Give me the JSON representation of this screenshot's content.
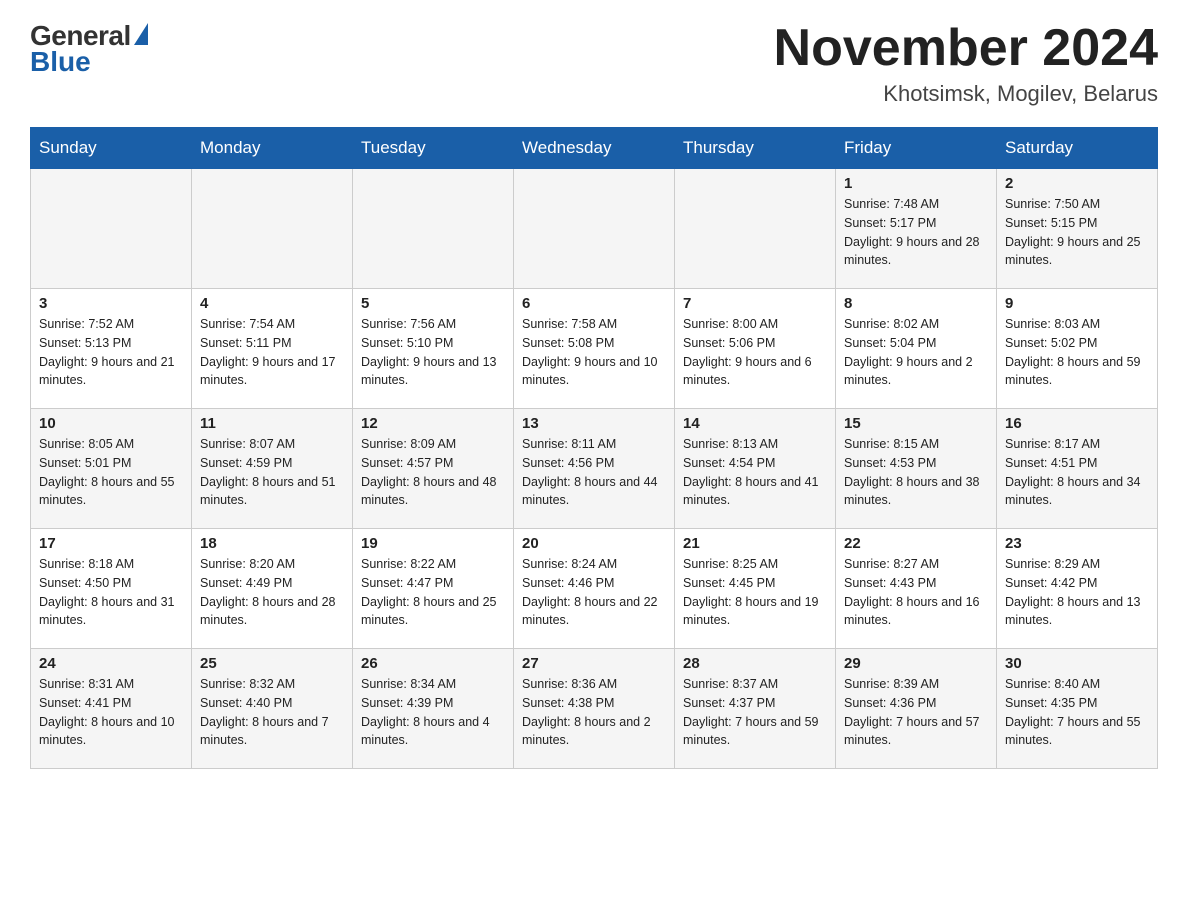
{
  "header": {
    "logo_general": "General",
    "logo_blue": "Blue",
    "month_title": "November 2024",
    "location": "Khotsimsk, Mogilev, Belarus"
  },
  "days_of_week": [
    "Sunday",
    "Monday",
    "Tuesday",
    "Wednesday",
    "Thursday",
    "Friday",
    "Saturday"
  ],
  "weeks": [
    [
      {
        "day": "",
        "info": ""
      },
      {
        "day": "",
        "info": ""
      },
      {
        "day": "",
        "info": ""
      },
      {
        "day": "",
        "info": ""
      },
      {
        "day": "",
        "info": ""
      },
      {
        "day": "1",
        "info": "Sunrise: 7:48 AM\nSunset: 5:17 PM\nDaylight: 9 hours and 28 minutes."
      },
      {
        "day": "2",
        "info": "Sunrise: 7:50 AM\nSunset: 5:15 PM\nDaylight: 9 hours and 25 minutes."
      }
    ],
    [
      {
        "day": "3",
        "info": "Sunrise: 7:52 AM\nSunset: 5:13 PM\nDaylight: 9 hours and 21 minutes."
      },
      {
        "day": "4",
        "info": "Sunrise: 7:54 AM\nSunset: 5:11 PM\nDaylight: 9 hours and 17 minutes."
      },
      {
        "day": "5",
        "info": "Sunrise: 7:56 AM\nSunset: 5:10 PM\nDaylight: 9 hours and 13 minutes."
      },
      {
        "day": "6",
        "info": "Sunrise: 7:58 AM\nSunset: 5:08 PM\nDaylight: 9 hours and 10 minutes."
      },
      {
        "day": "7",
        "info": "Sunrise: 8:00 AM\nSunset: 5:06 PM\nDaylight: 9 hours and 6 minutes."
      },
      {
        "day": "8",
        "info": "Sunrise: 8:02 AM\nSunset: 5:04 PM\nDaylight: 9 hours and 2 minutes."
      },
      {
        "day": "9",
        "info": "Sunrise: 8:03 AM\nSunset: 5:02 PM\nDaylight: 8 hours and 59 minutes."
      }
    ],
    [
      {
        "day": "10",
        "info": "Sunrise: 8:05 AM\nSunset: 5:01 PM\nDaylight: 8 hours and 55 minutes."
      },
      {
        "day": "11",
        "info": "Sunrise: 8:07 AM\nSunset: 4:59 PM\nDaylight: 8 hours and 51 minutes."
      },
      {
        "day": "12",
        "info": "Sunrise: 8:09 AM\nSunset: 4:57 PM\nDaylight: 8 hours and 48 minutes."
      },
      {
        "day": "13",
        "info": "Sunrise: 8:11 AM\nSunset: 4:56 PM\nDaylight: 8 hours and 44 minutes."
      },
      {
        "day": "14",
        "info": "Sunrise: 8:13 AM\nSunset: 4:54 PM\nDaylight: 8 hours and 41 minutes."
      },
      {
        "day": "15",
        "info": "Sunrise: 8:15 AM\nSunset: 4:53 PM\nDaylight: 8 hours and 38 minutes."
      },
      {
        "day": "16",
        "info": "Sunrise: 8:17 AM\nSunset: 4:51 PM\nDaylight: 8 hours and 34 minutes."
      }
    ],
    [
      {
        "day": "17",
        "info": "Sunrise: 8:18 AM\nSunset: 4:50 PM\nDaylight: 8 hours and 31 minutes."
      },
      {
        "day": "18",
        "info": "Sunrise: 8:20 AM\nSunset: 4:49 PM\nDaylight: 8 hours and 28 minutes."
      },
      {
        "day": "19",
        "info": "Sunrise: 8:22 AM\nSunset: 4:47 PM\nDaylight: 8 hours and 25 minutes."
      },
      {
        "day": "20",
        "info": "Sunrise: 8:24 AM\nSunset: 4:46 PM\nDaylight: 8 hours and 22 minutes."
      },
      {
        "day": "21",
        "info": "Sunrise: 8:25 AM\nSunset: 4:45 PM\nDaylight: 8 hours and 19 minutes."
      },
      {
        "day": "22",
        "info": "Sunrise: 8:27 AM\nSunset: 4:43 PM\nDaylight: 8 hours and 16 minutes."
      },
      {
        "day": "23",
        "info": "Sunrise: 8:29 AM\nSunset: 4:42 PM\nDaylight: 8 hours and 13 minutes."
      }
    ],
    [
      {
        "day": "24",
        "info": "Sunrise: 8:31 AM\nSunset: 4:41 PM\nDaylight: 8 hours and 10 minutes."
      },
      {
        "day": "25",
        "info": "Sunrise: 8:32 AM\nSunset: 4:40 PM\nDaylight: 8 hours and 7 minutes."
      },
      {
        "day": "26",
        "info": "Sunrise: 8:34 AM\nSunset: 4:39 PM\nDaylight: 8 hours and 4 minutes."
      },
      {
        "day": "27",
        "info": "Sunrise: 8:36 AM\nSunset: 4:38 PM\nDaylight: 8 hours and 2 minutes."
      },
      {
        "day": "28",
        "info": "Sunrise: 8:37 AM\nSunset: 4:37 PM\nDaylight: 7 hours and 59 minutes."
      },
      {
        "day": "29",
        "info": "Sunrise: 8:39 AM\nSunset: 4:36 PM\nDaylight: 7 hours and 57 minutes."
      },
      {
        "day": "30",
        "info": "Sunrise: 8:40 AM\nSunset: 4:35 PM\nDaylight: 7 hours and 55 minutes."
      }
    ]
  ]
}
